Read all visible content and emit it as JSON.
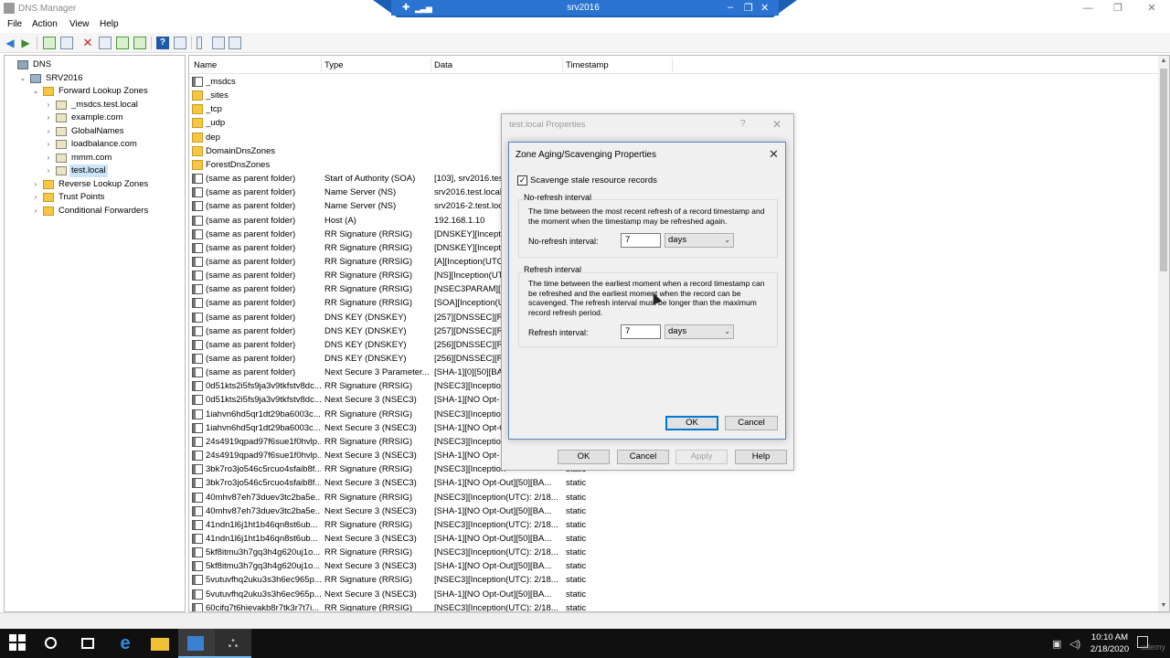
{
  "window": {
    "title": "DNS Manager"
  },
  "remote_session": {
    "host": "srv2016"
  },
  "menu": [
    "File",
    "Action",
    "View",
    "Help"
  ],
  "tree": [
    {
      "label": "DNS",
      "indent": 0,
      "expander": "",
      "icon": "dns"
    },
    {
      "label": "SRV2016",
      "indent": 1,
      "expander": "⌄",
      "icon": "server"
    },
    {
      "label": "Forward Lookup Zones",
      "indent": 2,
      "expander": "⌄",
      "icon": "folder"
    },
    {
      "label": "_msdcs.test.local",
      "indent": 3,
      "expander": "›",
      "icon": "zone"
    },
    {
      "label": "example.com",
      "indent": 3,
      "expander": "›",
      "icon": "zone"
    },
    {
      "label": "GlobalNames",
      "indent": 3,
      "expander": "›",
      "icon": "zone"
    },
    {
      "label": "loadbalance.com",
      "indent": 3,
      "expander": "›",
      "icon": "zone"
    },
    {
      "label": "mmm.com",
      "indent": 3,
      "expander": "›",
      "icon": "zone"
    },
    {
      "label": "test.local",
      "indent": 3,
      "expander": "›",
      "icon": "zone",
      "selected": true
    },
    {
      "label": "Reverse Lookup Zones",
      "indent": 2,
      "expander": "›",
      "icon": "folder"
    },
    {
      "label": "Trust Points",
      "indent": 2,
      "expander": "›",
      "icon": "folder"
    },
    {
      "label": "Conditional Forwarders",
      "indent": 2,
      "expander": "›",
      "icon": "folder"
    }
  ],
  "list": {
    "columns": [
      "Name",
      "Type",
      "Data",
      "Timestamp"
    ],
    "rows": [
      {
        "icon": "record",
        "name": "_msdcs",
        "type": "",
        "data": "",
        "ts": ""
      },
      {
        "icon": "folder",
        "name": "_sites",
        "type": "",
        "data": "",
        "ts": ""
      },
      {
        "icon": "folder",
        "name": "_tcp",
        "type": "",
        "data": "",
        "ts": ""
      },
      {
        "icon": "folder",
        "name": "_udp",
        "type": "",
        "data": "",
        "ts": ""
      },
      {
        "icon": "folder",
        "name": "dep",
        "type": "",
        "data": "",
        "ts": ""
      },
      {
        "icon": "folder",
        "name": "DomainDnsZones",
        "type": "",
        "data": "",
        "ts": ""
      },
      {
        "icon": "folder",
        "name": "ForestDnsZones",
        "type": "",
        "data": "",
        "ts": ""
      },
      {
        "icon": "record",
        "name": "(same as parent folder)",
        "type": "Start of Authority (SOA)",
        "data": "[103], srv2016.test",
        "ts": ""
      },
      {
        "icon": "record",
        "name": "(same as parent folder)",
        "type": "Name Server (NS)",
        "data": "srv2016.test.local.",
        "ts": ""
      },
      {
        "icon": "record",
        "name": "(same as parent folder)",
        "type": "Name Server (NS)",
        "data": "srv2016-2.test.loca",
        "ts": ""
      },
      {
        "icon": "record",
        "name": "(same as parent folder)",
        "type": "Host (A)",
        "data": "192.168.1.10",
        "ts": ""
      },
      {
        "icon": "record",
        "name": "(same as parent folder)",
        "type": "RR Signature (RRSIG)",
        "data": "[DNSKEY][Inceptio",
        "ts": ""
      },
      {
        "icon": "record",
        "name": "(same as parent folder)",
        "type": "RR Signature (RRSIG)",
        "data": "[DNSKEY][Inceptio",
        "ts": ""
      },
      {
        "icon": "record",
        "name": "(same as parent folder)",
        "type": "RR Signature (RRSIG)",
        "data": "[A][Inception(UTC",
        "ts": ""
      },
      {
        "icon": "record",
        "name": "(same as parent folder)",
        "type": "RR Signature (RRSIG)",
        "data": "[NS][Inception(UT",
        "ts": ""
      },
      {
        "icon": "record",
        "name": "(same as parent folder)",
        "type": "RR Signature (RRSIG)",
        "data": "[NSEC3PARAM][In",
        "ts": ""
      },
      {
        "icon": "record",
        "name": "(same as parent folder)",
        "type": "RR Signature (RRSIG)",
        "data": "[SOA][Inception(U",
        "ts": ""
      },
      {
        "icon": "record",
        "name": "(same as parent folder)",
        "type": "DNS KEY (DNSKEY)",
        "data": "[257][DNSSEC][RS",
        "ts": ""
      },
      {
        "icon": "record",
        "name": "(same as parent folder)",
        "type": "DNS KEY (DNSKEY)",
        "data": "[257][DNSSEC][RS",
        "ts": ""
      },
      {
        "icon": "record",
        "name": "(same as parent folder)",
        "type": "DNS KEY (DNSKEY)",
        "data": "[256][DNSSEC][RS",
        "ts": ""
      },
      {
        "icon": "record",
        "name": "(same as parent folder)",
        "type": "DNS KEY (DNSKEY)",
        "data": "[256][DNSSEC][RS",
        "ts": ""
      },
      {
        "icon": "record",
        "name": "(same as parent folder)",
        "type": "Next Secure 3 Parameter...",
        "data": "[SHA-1][0][50][BA",
        "ts": ""
      },
      {
        "icon": "record",
        "name": "0d51kts2i5fs9ja3v9tkfstv8dc...",
        "type": "RR Signature (RRSIG)",
        "data": "[NSEC3][Inception",
        "ts": ""
      },
      {
        "icon": "record",
        "name": "0d51kts2i5fs9ja3v9tkfstv8dc...",
        "type": "Next Secure 3 (NSEC3)",
        "data": "[SHA-1][NO Opt-",
        "ts": ""
      },
      {
        "icon": "record",
        "name": "1iahvn6hd5qr1dt29ba6003c...",
        "type": "RR Signature (RRSIG)",
        "data": "[NSEC3][Inception",
        "ts": ""
      },
      {
        "icon": "record",
        "name": "1iahvn6hd5qr1dt29ba6003c...",
        "type": "Next Secure 3 (NSEC3)",
        "data": "[SHA-1][NO Opt-O",
        "ts": ""
      },
      {
        "icon": "record",
        "name": "24s4919qpad97f6sue1f0hvlp...",
        "type": "RR Signature (RRSIG)",
        "data": "[NSEC3][Inception",
        "ts": ""
      },
      {
        "icon": "record",
        "name": "24s4919qpad97f6sue1f0hvlp...",
        "type": "Next Secure 3 (NSEC3)",
        "data": "[SHA-1][NO Opt-",
        "ts": ""
      },
      {
        "icon": "record",
        "name": "3bk7ro3jo546c5rcuo4sfaib8f...",
        "type": "RR Signature (RRSIG)",
        "data": "[NSEC3][Inception",
        "ts": "static"
      },
      {
        "icon": "record",
        "name": "3bk7ro3jo546c5rcuo4sfaib8f...",
        "type": "Next Secure 3 (NSEC3)",
        "data": "[SHA-1][NO Opt-Out][50][BA...",
        "ts": "static"
      },
      {
        "icon": "record",
        "name": "40mhv87eh73duev3tc2ba5e...",
        "type": "RR Signature (RRSIG)",
        "data": "[NSEC3][Inception(UTC): 2/18...",
        "ts": "static"
      },
      {
        "icon": "record",
        "name": "40mhv87eh73duev3tc2ba5e...",
        "type": "Next Secure 3 (NSEC3)",
        "data": "[SHA-1][NO Opt-Out][50][BA...",
        "ts": "static"
      },
      {
        "icon": "record",
        "name": "41ndn1l6j1ht1b46qn8st6ub...",
        "type": "RR Signature (RRSIG)",
        "data": "[NSEC3][Inception(UTC): 2/18...",
        "ts": "static"
      },
      {
        "icon": "record",
        "name": "41ndn1l6j1ht1b46qn8st6ub...",
        "type": "Next Secure 3 (NSEC3)",
        "data": "[SHA-1][NO Opt-Out][50][BA...",
        "ts": "static"
      },
      {
        "icon": "record",
        "name": "5kf8itmu3h7gq3h4g620uj1o...",
        "type": "RR Signature (RRSIG)",
        "data": "[NSEC3][Inception(UTC): 2/18...",
        "ts": "static"
      },
      {
        "icon": "record",
        "name": "5kf8itmu3h7gq3h4g620uj1o...",
        "type": "Next Secure 3 (NSEC3)",
        "data": "[SHA-1][NO Opt-Out][50][BA...",
        "ts": "static"
      },
      {
        "icon": "record",
        "name": "5vutuvfhq2uku3s3h6ec965p...",
        "type": "RR Signature (RRSIG)",
        "data": "[NSEC3][Inception(UTC): 2/18...",
        "ts": "static"
      },
      {
        "icon": "record",
        "name": "5vutuvfhq2uku3s3h6ec965p...",
        "type": "Next Secure 3 (NSEC3)",
        "data": "[SHA-1][NO Opt-Out][50][BA...",
        "ts": "static"
      },
      {
        "icon": "record",
        "name": "60cifq7t6hievakb8r7tk3r7t7i...",
        "type": "RR Signature (RRSIG)",
        "data": "[NSEC3][Inception(UTC): 2/18...",
        "ts": "static"
      }
    ]
  },
  "properties_dialog": {
    "title": "test.local Properties",
    "help_glyph": "?",
    "ok": "OK",
    "cancel": "Cancel",
    "apply": "Apply",
    "help": "Help"
  },
  "aging_dialog": {
    "title": "Zone Aging/Scavenging Properties",
    "scavenge_checked": true,
    "scavenge_label": "Scavenge stale resource records",
    "no_refresh": {
      "group": "No-refresh interval",
      "description": "The time between the most recent refresh of a record timestamp and the moment when the timestamp may be refreshed again.",
      "label": "No-refresh interval:",
      "value": "7",
      "unit": "days"
    },
    "refresh": {
      "group": "Refresh interval",
      "description": "The time between the earliest moment when a record timestamp can be refreshed and the earliest moment when the record can be scavenged. The refresh interval must be longer than the maximum record refresh period.",
      "label": "Refresh interval:",
      "value": "7",
      "unit": "days"
    },
    "ok": "OK",
    "cancel": "Cancel"
  },
  "taskbar": {
    "time": "10:10 AM",
    "date": "2/18/2020"
  },
  "watermark": "udemy",
  "colors": {
    "accent": "#0078d7",
    "rdp_bar": "#2b73d1",
    "selection": "#cce4f7",
    "folder": "#f6c744"
  }
}
